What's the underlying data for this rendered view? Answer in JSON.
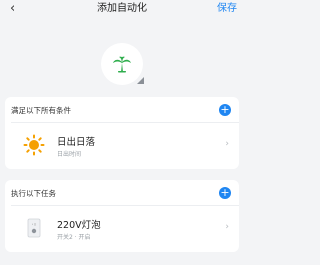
{
  "header": {
    "back_icon": "‹",
    "title": "添加自动化",
    "save_label": "保存"
  },
  "avatar": {
    "icon": "palm-tree-icon"
  },
  "conditions": {
    "heading": "满足以下所有条件",
    "add_icon": "+",
    "items": [
      {
        "icon": "sun-icon",
        "title": "日出日落",
        "subtitle": "日出时间",
        "chevron": "›"
      }
    ]
  },
  "tasks": {
    "heading": "执行以下任务",
    "add_icon": "+",
    "items": [
      {
        "icon": "light-switch-icon",
        "title": "220V灯泡",
        "subtitle": "开关2 · 开启",
        "chevron": "›"
      }
    ]
  },
  "colors": {
    "accent": "#1f86f2",
    "sun": "#f5a000",
    "palm": "#2fae4d",
    "background": "#f3f4f6"
  }
}
